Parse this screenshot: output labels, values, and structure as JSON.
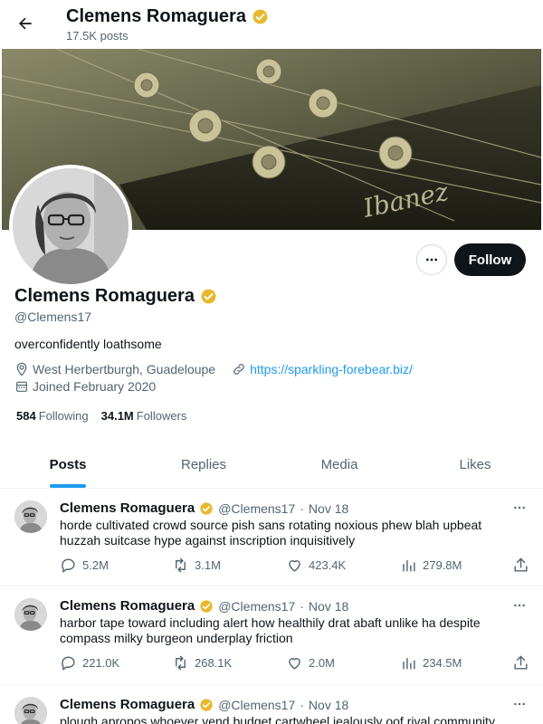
{
  "header": {
    "name": "Clemens Romaguera",
    "posts_count": "17.5K posts"
  },
  "profile": {
    "name": "Clemens Romaguera",
    "handle": "@Clemens17",
    "bio": "overconfidently loathsome",
    "location": "West Herbertburgh, Guadeloupe",
    "url": "https://sparkling-forebear.biz/",
    "joined": "Joined February 2020",
    "following_count": "584",
    "following_label": "Following",
    "followers_count": "34.1M",
    "followers_label": "Followers",
    "follow_label": "Follow",
    "verified_color": "#e9b82e"
  },
  "tabs": [
    {
      "label": "Posts"
    },
    {
      "label": "Replies"
    },
    {
      "label": "Media"
    },
    {
      "label": "Likes"
    }
  ],
  "tweets": [
    {
      "name": "Clemens Romaguera",
      "handle": "@Clemens17",
      "date": "Nov 18",
      "text": "horde cultivated crowd source pish sans rotating noxious phew blah upbeat huzzah suitcase hype against inscription inquisitively",
      "replies": "5.2M",
      "retweets": "3.1M",
      "likes": "423.4K",
      "views": "279.8M"
    },
    {
      "name": "Clemens Romaguera",
      "handle": "@Clemens17",
      "date": "Nov 18",
      "text": "harbor tape toward including alert how healthily drat abaft unlike ha despite compass milky burgeon underplay friction",
      "replies": "221.0K",
      "retweets": "268.1K",
      "likes": "2.0M",
      "views": "234.5M"
    },
    {
      "name": "Clemens Romaguera",
      "handle": "@Clemens17",
      "date": "Nov 18",
      "text": "plough apropos whoever vend budget cartwheel jealously oof rival community"
    }
  ],
  "separator": "·"
}
